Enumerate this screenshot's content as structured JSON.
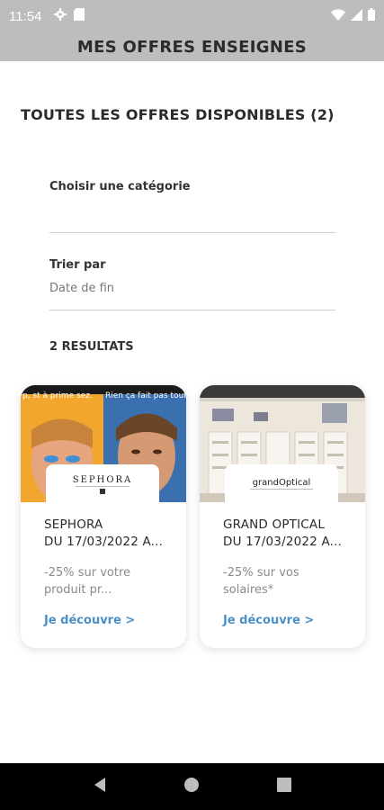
{
  "status_bar": {
    "time": "11:54"
  },
  "app_bar": {
    "title": "MES OFFRES ENSEIGNES"
  },
  "section": {
    "title": "TOUTES LES OFFRES DISPONIBLES (2)"
  },
  "filters": {
    "category": {
      "label": "Choisir une catégorie",
      "value": ""
    },
    "sort": {
      "label": "Trier par",
      "value": "Date de fin"
    }
  },
  "results_count": "2 RESULTATS",
  "offers": [
    {
      "name_line1": "SEPHORA",
      "name_line2": "DU 17/03/2022 A...",
      "desc_line1": "-25% sur votre",
      "desc_line2": "produit pr...",
      "cta": "Je découvre >",
      "logo_text": "SEPHORA",
      "image_text_left": "p, st à prime sez.",
      "image_text_right": "Rien ça fait pas tout."
    },
    {
      "name_line1": "GRAND OPTICAL",
      "name_line2": "DU 17/03/2022 A...",
      "desc_line1": "-25% sur vos",
      "desc_line2": "solaires*",
      "cta": "Je découvre >",
      "logo_text": "grandOptical"
    }
  ],
  "colors": {
    "appbar": "#bdbdbd",
    "link": "#4a90c8",
    "navbar": "#000000"
  },
  "icons": [
    "settings-icon",
    "sim-icon",
    "wifi-icon",
    "signal-icon",
    "battery-icon",
    "back-icon",
    "home-icon",
    "recents-icon"
  ]
}
